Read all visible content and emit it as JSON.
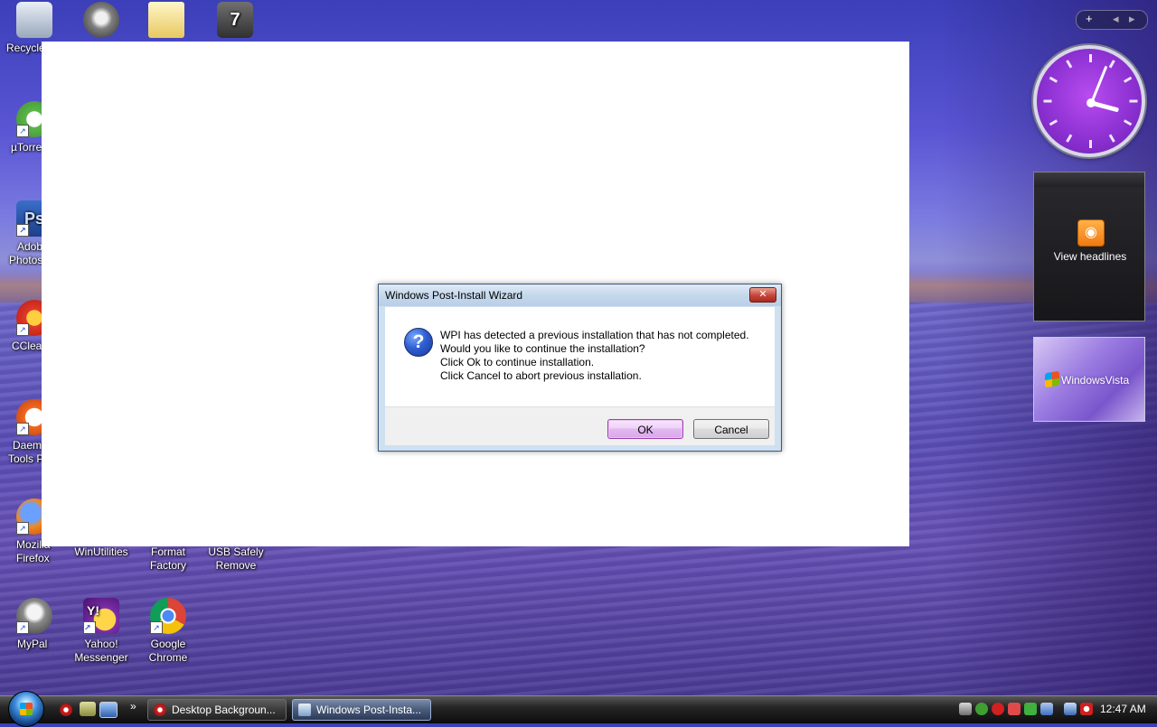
{
  "desktop": {
    "icons": [
      {
        "label": "Recycle"
      },
      {
        "label": "µTorre"
      },
      {
        "label": "Adob"
      },
      {
        "label": "Photos"
      },
      {
        "label": "CClea"
      },
      {
        "label": "Daem"
      },
      {
        "label": "Tools P"
      },
      {
        "label": "Mozilla"
      },
      {
        "label": "Firefox"
      },
      {
        "label": "WinUtilities"
      },
      {
        "label": "Format"
      },
      {
        "label": "Factory"
      },
      {
        "label": "USB Safely"
      },
      {
        "label": "Remove"
      },
      {
        "label": "MyPal"
      },
      {
        "label": "Yahoo!"
      },
      {
        "label": "Messenger"
      },
      {
        "label": "Google"
      },
      {
        "label": "Chrome"
      }
    ]
  },
  "dialog": {
    "title": "Windows Post-Install Wizard",
    "close_label": "✕",
    "icon": "question-icon",
    "message": [
      "WPI has detected a previous installation that has not completed.",
      "Would you like to continue the installation?",
      "Click Ok to continue installation.",
      "Click Cancel to abort previous installation."
    ],
    "ok_label": "OK",
    "cancel_label": "Cancel"
  },
  "gadgets": {
    "controls": {
      "add": "+",
      "prev": "◂",
      "next": "▸"
    },
    "feed_text": "View headlines",
    "slideshow_text": "WindowsVista"
  },
  "taskbar": {
    "tasks": [
      {
        "label": "Desktop Backgroun...",
        "active": false
      },
      {
        "label": "Windows Post-Insta...",
        "active": true
      }
    ],
    "more": "»",
    "clock": "12:47 AM"
  },
  "colors": {
    "dialog_border": "#3c5a7c",
    "ok_button": "#a03fb0",
    "clock_face": "#8a2fd0",
    "rss": "#f07a10"
  }
}
